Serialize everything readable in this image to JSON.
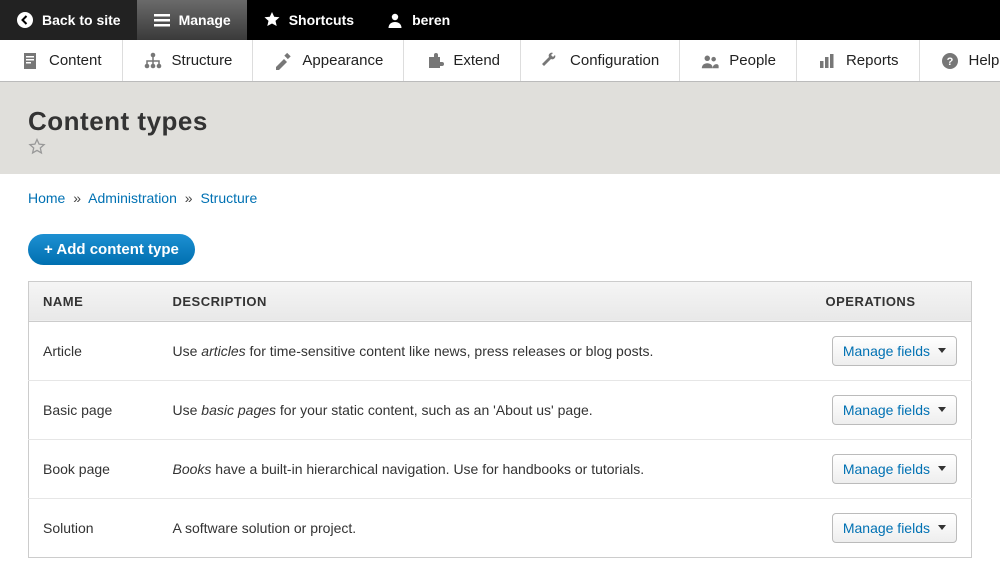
{
  "topbar": {
    "back": "Back to site",
    "manage": "Manage",
    "shortcuts": "Shortcuts",
    "user": "beren"
  },
  "adminmenu": {
    "content": "Content",
    "structure": "Structure",
    "appearance": "Appearance",
    "extend": "Extend",
    "configuration": "Configuration",
    "people": "People",
    "reports": "Reports",
    "help": "Help"
  },
  "page": {
    "title": "Content types"
  },
  "breadcrumb": {
    "home": "Home",
    "admin": "Administration",
    "structure": "Structure"
  },
  "buttons": {
    "add": "+ Add content type",
    "manage_fields": "Manage fields"
  },
  "table": {
    "head_name": "NAME",
    "head_desc": "DESCRIPTION",
    "head_ops": "OPERATIONS",
    "rows": [
      {
        "name": "Article",
        "desc_prefix": "Use ",
        "desc_em": "articles",
        "desc_suffix": " for time-sensitive content like news, press releases or blog posts."
      },
      {
        "name": "Basic page",
        "desc_prefix": "Use ",
        "desc_em": "basic pages",
        "desc_suffix": " for your static content, such as an 'About us' page."
      },
      {
        "name": "Book page",
        "desc_prefix": "",
        "desc_em": "Books",
        "desc_suffix": " have a built-in hierarchical navigation. Use for handbooks or tutorials."
      },
      {
        "name": "Solution",
        "desc_prefix": "A software solution or project.",
        "desc_em": "",
        "desc_suffix": ""
      }
    ]
  }
}
